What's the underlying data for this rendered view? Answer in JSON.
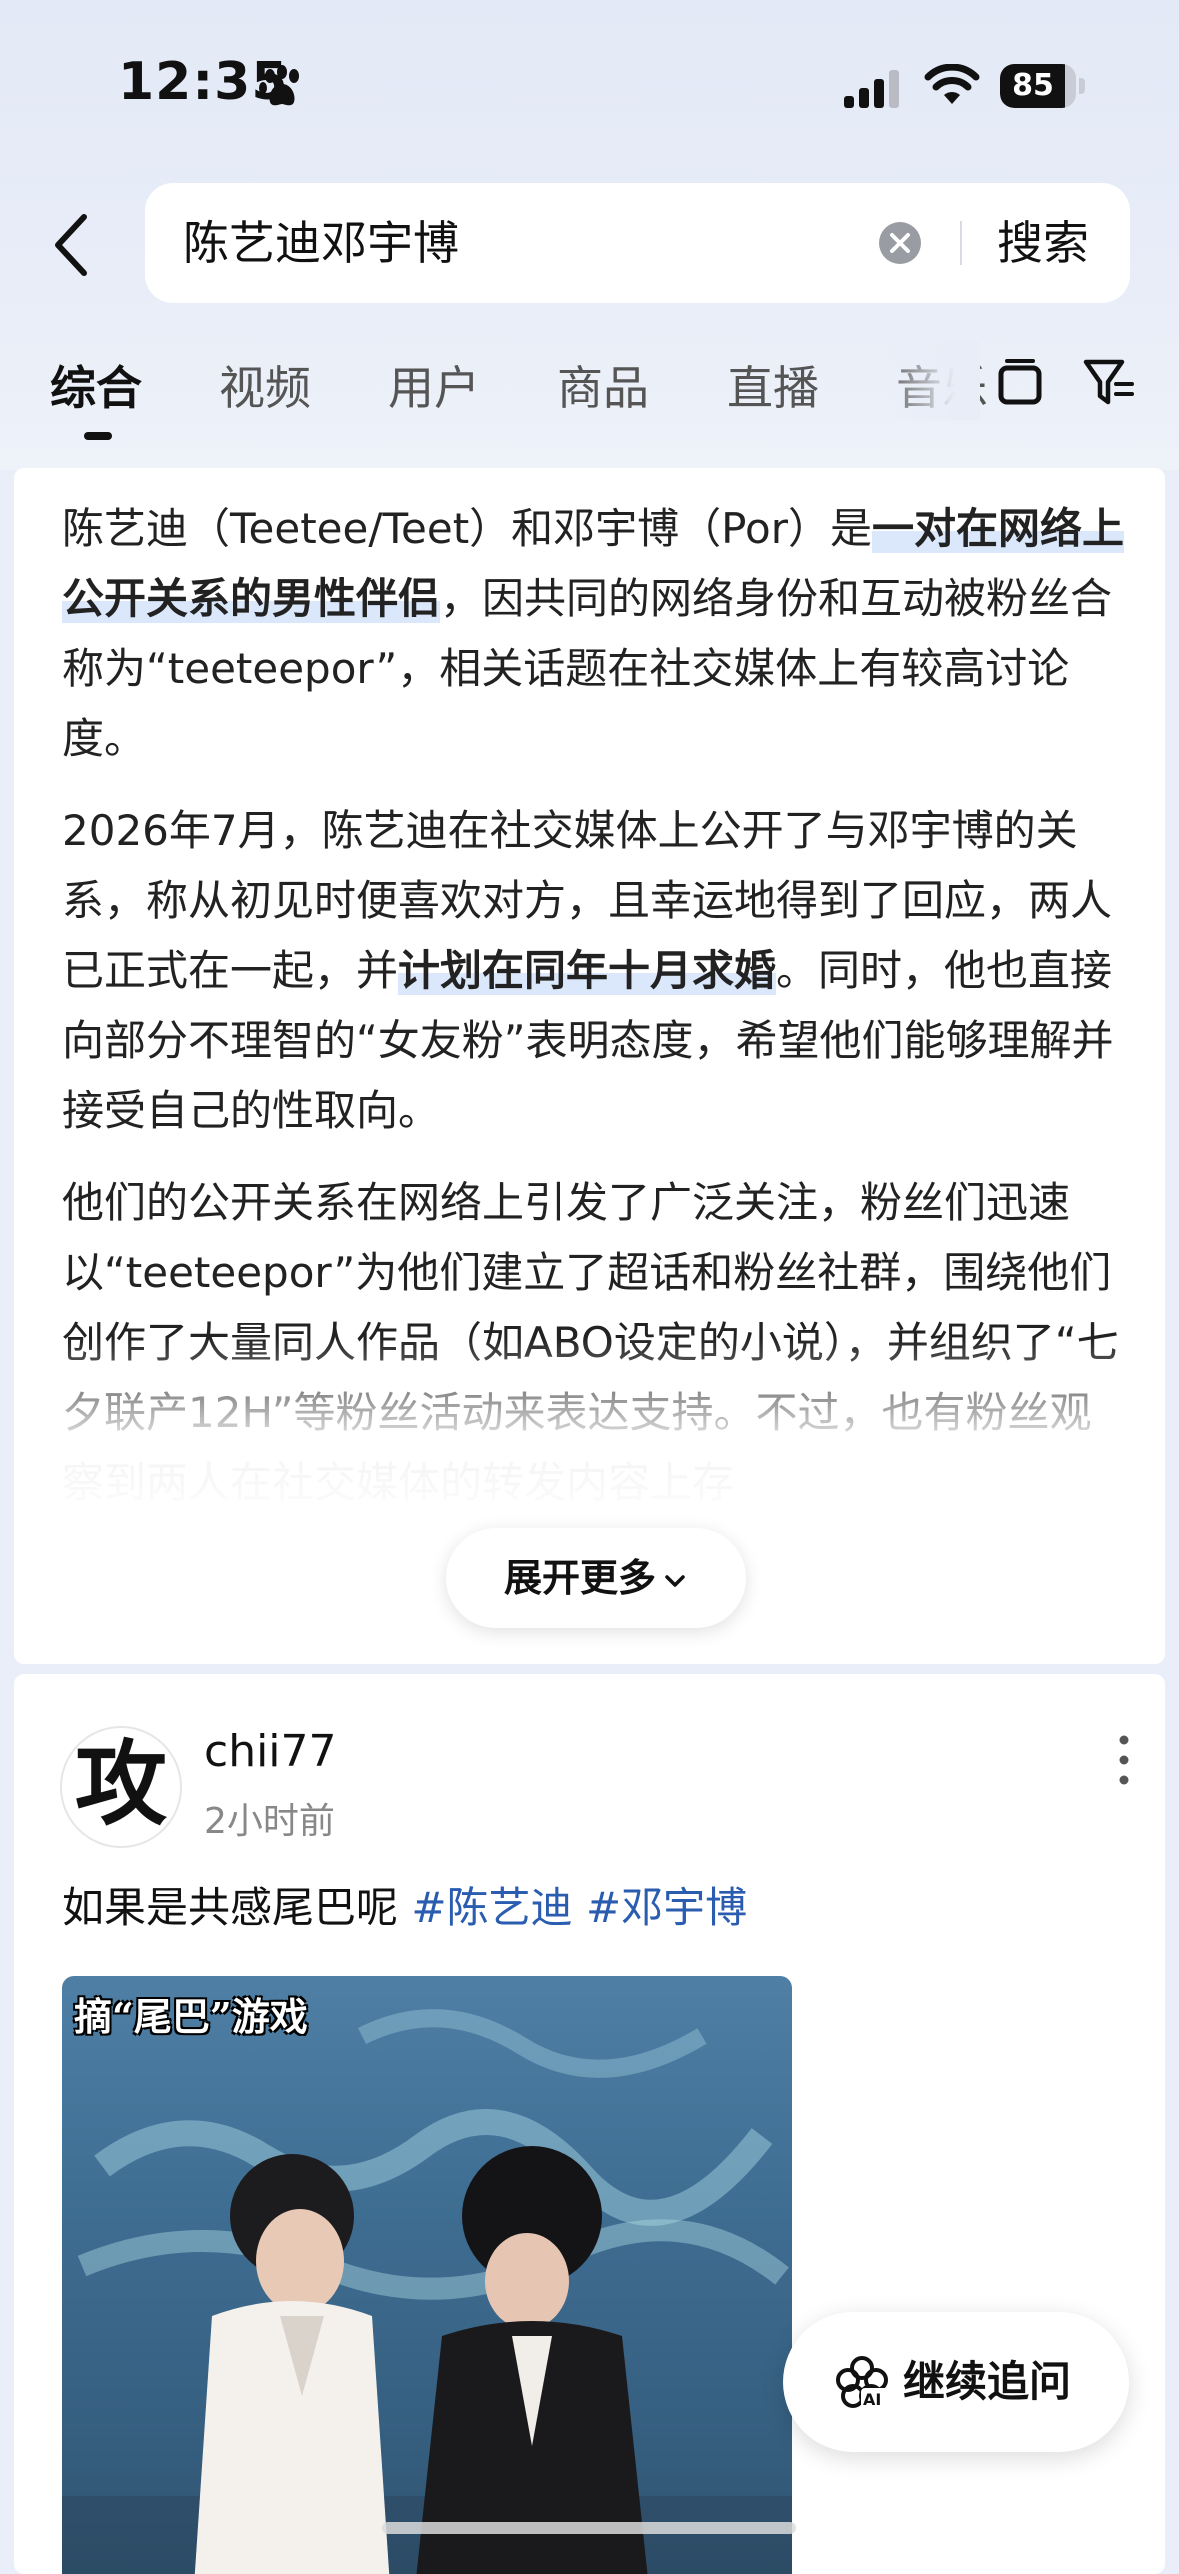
{
  "status_bar": {
    "time": "12:35",
    "battery": "85",
    "battery_level": 0.85
  },
  "search": {
    "query": "陈艺迪邓宇博",
    "button_label": "搜索"
  },
  "tabs": [
    {
      "label": "综合",
      "active": true
    },
    {
      "label": "视频"
    },
    {
      "label": "用户"
    },
    {
      "label": "商品"
    },
    {
      "label": "直播"
    },
    {
      "label": "音乐"
    }
  ],
  "ai_summary": {
    "p1": {
      "a": "陈艺迪（Teetee/Teet）和邓宇博（Por）是",
      "b": "一对在网络上公开关系的男性伴侣",
      "c": "，因共同的网络身份和互动被粉丝合称为“teeteepor”，相关话题在社交媒体上有较高讨论度。"
    },
    "p2": {
      "a": "2026年7月，陈艺迪在社交媒体上公开了与邓宇博的关系，称从初见时便喜欢对方，且幸运地得到了回应，两人已正式在一起，并",
      "b": "计划在同年十月求婚",
      "c": "。同时，他也直接向部分不理智的“女友粉”表明态度，希望他们能够理解并接受自己的性取向。"
    },
    "p3": "他们的公开关系在网络上引发了广泛关注，粉丝们迅速以“teeteepor”为他们建立了超话和粉丝社群，围绕他们创作了大量同人作品（如ABO设定的小说），并组织了“七夕联产12H”等粉丝活动来表达支持。不过，也有粉丝观察到两人在社交媒体的转发内容上存",
    "expand_label": "展开更多"
  },
  "post": {
    "avatar_char": "攻",
    "username": "chii77",
    "time": "2小时前",
    "text": "如果是共感尾巴呢",
    "hashtags": [
      "#陈艺迪",
      "#邓宇博"
    ],
    "image_caption": "摘“尾巴”游戏"
  },
  "followup": {
    "label": "继续追问"
  },
  "colors": {
    "accent": "#2a5db0",
    "highlight": "#dbe7fb",
    "background": "#e9eef8"
  }
}
